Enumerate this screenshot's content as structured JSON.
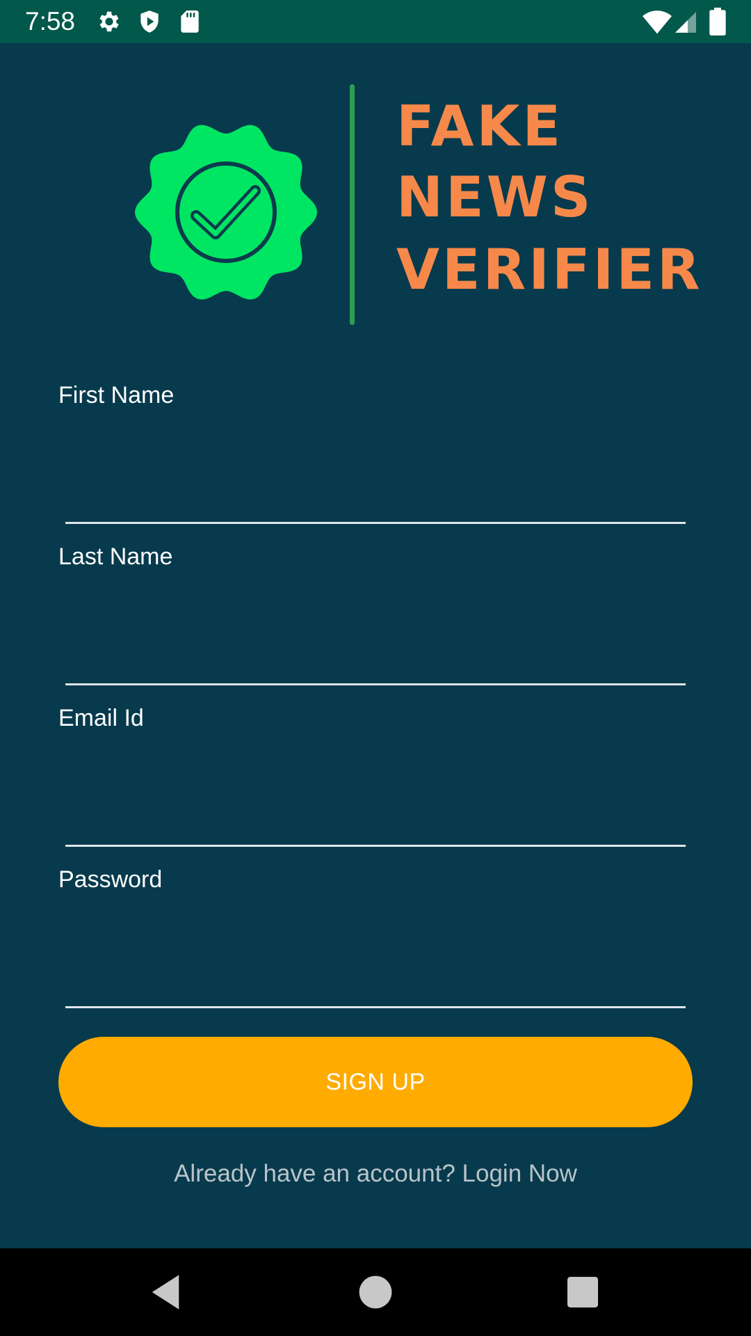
{
  "status_bar": {
    "time": "7:58",
    "left_icons": [
      "gear-icon",
      "shield-play-icon",
      "sd-card-icon"
    ],
    "right_icons": [
      "wifi-icon",
      "cell-signal-icon",
      "battery-icon"
    ],
    "bg_color": "#02584a"
  },
  "logo": {
    "line1": "FAKE",
    "line2": "NEWS",
    "line3": "VERIFIER",
    "badge_icon": "verified-check-badge-icon",
    "badge_color": "#00e663",
    "text_color": "#f6894a"
  },
  "form": {
    "first_name": {
      "label": "First Name",
      "value": ""
    },
    "last_name": {
      "label": "Last Name",
      "value": ""
    },
    "email": {
      "label": "Email Id",
      "value": ""
    },
    "password": {
      "label": "Password",
      "value": ""
    }
  },
  "signup_button": {
    "label": "SIGN UP",
    "color": "#ffab00"
  },
  "login_prompt": "Already have an account? Login Now",
  "nav_bar": {
    "buttons": [
      "back-icon",
      "home-icon",
      "recents-icon"
    ]
  },
  "colors": {
    "background": "#083a4d"
  }
}
